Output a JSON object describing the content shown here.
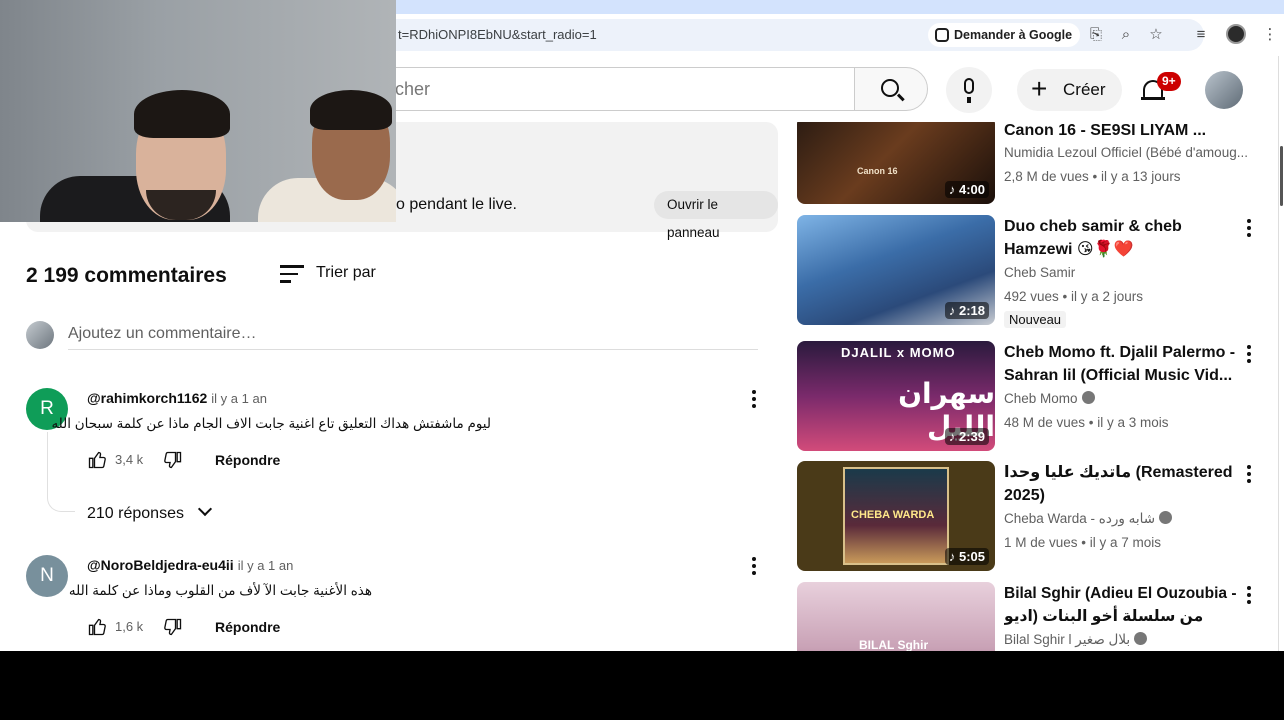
{
  "browser": {
    "url": "t=RDhiONPI8EbNU&start_radio=1",
    "ask_google_label": "Demander à Google"
  },
  "header": {
    "search_placeholder": "cher",
    "create_label": "Créer",
    "notifications_badge": "9+"
  },
  "live_panel": {
    "text": "o pendant le live.",
    "button_label": "Ouvrir le panneau"
  },
  "comments": {
    "count_label": "2 199 commentaires",
    "sort_label": "Trier par",
    "add_placeholder": "Ajoutez un commentaire…",
    "items": [
      {
        "avatar_letter": "R",
        "avatar_color": "#0f9d58",
        "author": "@rahimkorch1162",
        "time": "il y a 1 an",
        "text": "ليوم ماشفتش هداك التعليق تاع اغنية جابت الاف الجام ماذا عن كلمة سبحان الله",
        "likes": "3,4 k",
        "reply_label": "Répondre",
        "replies_label": "210 réponses"
      },
      {
        "avatar_letter": "N",
        "avatar_color": "#78909c",
        "author": "@NoroBeldjedra-eu4ii",
        "time": "il y a 1 an",
        "text": "هذه الأغنية جابت الآ لأف من القلوب وماذا عن كلمة الله",
        "likes": "1,6 k",
        "reply_label": "Répondre"
      }
    ]
  },
  "sidebar": {
    "videos": [
      {
        "title": "Canon 16 - SE9SI LIYAM ...",
        "channel": "Numidia Lezoul Officiel (Bébé d'amoug...",
        "meta": "2,8 M de vues • il y a 13 jours",
        "duration": "♪ 4:00",
        "thumb_text": "Canon 16"
      },
      {
        "title": "Duo cheb samir & cheb Hamzewi 😘🌹❤️",
        "channel": "Cheb Samir",
        "meta": "492 vues • il y a 2 jours",
        "badge": "Nouveau",
        "duration": "♪ 2:18"
      },
      {
        "title": "Cheb Momo ft. Djalil Palermo - Sahran lil (Official Music Vid...",
        "channel": "Cheb Momo",
        "meta": "48 M de vues • il y a 3 mois",
        "duration": "♪ 2:39",
        "thumb_text": "DJALIL x MOMO",
        "thumb_text_ar": "سهران الليل"
      },
      {
        "title": "ماتديك عليا وحدا (Remastered 2025)",
        "channel": "Cheba Warda - شابه ورده",
        "meta": "1 M de vues • il y a 7 mois",
        "duration": "♪ 5:05",
        "thumb_text": "CHEBA WARDA"
      },
      {
        "title": "Bilal Sghir (Adieu El Ouzoubia - من سلسلة أخو البنات (اديو العزوبية",
        "channel": "Bilal Sghir l بلال صغير",
        "thumb_text": "BILAL Sghir"
      }
    ]
  }
}
